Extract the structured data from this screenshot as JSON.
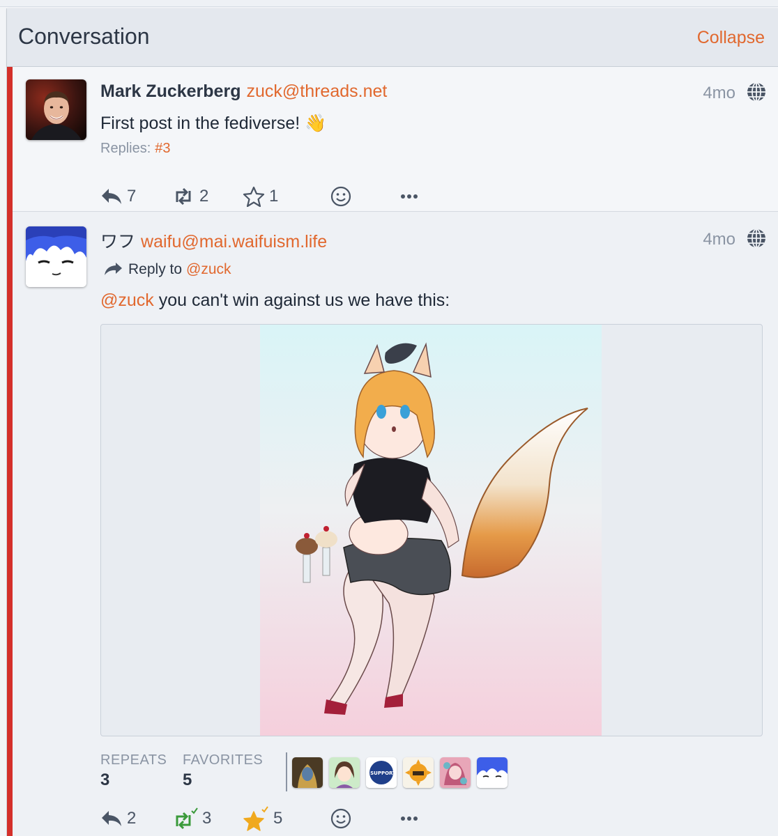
{
  "panel": {
    "title": "Conversation",
    "collapse_label": "Collapse"
  },
  "statuses": [
    {
      "display_name": "Mark Zuckerberg",
      "handle": "zuck@threads.net",
      "time": "4mo",
      "text": "First post in the fediverse! 👋",
      "replies_label": "Replies:",
      "reply_link": "#3",
      "actions": {
        "reply_count": "7",
        "repeat_count": "2",
        "favorite_count": "1"
      },
      "icons": {
        "reply": "reply-icon",
        "repeat": "repeat-icon",
        "favorite": "star-outline-icon",
        "emoji": "smiley-icon",
        "more": "more-dots-icon",
        "visibility": "globe-icon"
      }
    },
    {
      "display_name": "ワフ",
      "handle": "waifu@mai.waifuism.life",
      "time": "4mo",
      "reply_to_label": "Reply to",
      "reply_to_mention": "@zuck",
      "text_mention": "@zuck",
      "text": " you can't win against us we have this:",
      "stats": {
        "repeats_label": "REPEATS",
        "repeats_value": "3",
        "favorites_label": "FAVORITES",
        "favorites_value": "5"
      },
      "mini_avatar_badge_text": "I SUPPORT",
      "actions": {
        "reply_count": "2",
        "repeat_count": "3",
        "favorite_count": "5"
      },
      "colors": {
        "repeated": "#3a9a3a",
        "favorited": "#f0a91e"
      }
    }
  ],
  "colors": {
    "accent": "#e1682e",
    "rail": "#d4302a",
    "muted": "#8a94a3"
  }
}
